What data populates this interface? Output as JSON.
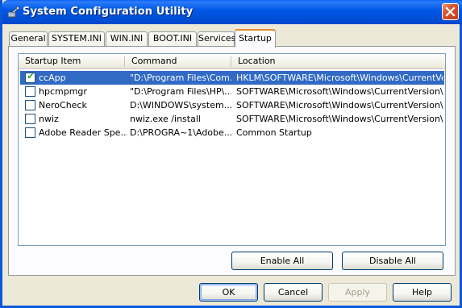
{
  "window": {
    "title": "System Configuration Utility"
  },
  "tabs": [
    {
      "label": "General"
    },
    {
      "label": "SYSTEM.INI"
    },
    {
      "label": "WIN.INI"
    },
    {
      "label": "BOOT.INI"
    },
    {
      "label": "Services"
    },
    {
      "label": "Startup",
      "active": true
    }
  ],
  "columns": [
    "Startup Item",
    "Command",
    "Location"
  ],
  "rows": [
    {
      "item": "ccApp",
      "command": "\"D:\\Program Files\\Com...",
      "location": "HKLM\\SOFTWARE\\Microsoft\\Windows\\CurrentVer...",
      "checked": true,
      "selected": true
    },
    {
      "item": "hpcmpmgr",
      "command": "\"D:\\Program Files\\HP\\...",
      "location": "SOFTWARE\\Microsoft\\Windows\\CurrentVersion\\Run",
      "checked": false,
      "selected": false
    },
    {
      "item": "NeroCheck",
      "command": "D:\\WINDOWS\\system...",
      "location": "SOFTWARE\\Microsoft\\Windows\\CurrentVersion\\Run",
      "checked": false,
      "selected": false
    },
    {
      "item": "nwiz",
      "command": "nwiz.exe /install",
      "location": "SOFTWARE\\Microsoft\\Windows\\CurrentVersion\\Run",
      "checked": false,
      "selected": false
    },
    {
      "item": "Adobe Reader Spe...",
      "command": "D:\\PROGRA~1\\Adobe...",
      "location": "Common Startup",
      "checked": false,
      "selected": false
    }
  ],
  "buttons": {
    "enable_all": "Enable All",
    "disable_all": "Disable All",
    "ok": "OK",
    "cancel": "Cancel",
    "apply": "Apply",
    "help": "Help"
  },
  "icons": {
    "title_icon": "msconfig-app-icon",
    "close": "close-icon",
    "check": "check-icon"
  },
  "colors": {
    "titlebar": "#0058e6",
    "selection": "#316ac5",
    "close_button": "#d7542f",
    "active_tab_accent": "#e68b2c",
    "check": "#21a121"
  }
}
